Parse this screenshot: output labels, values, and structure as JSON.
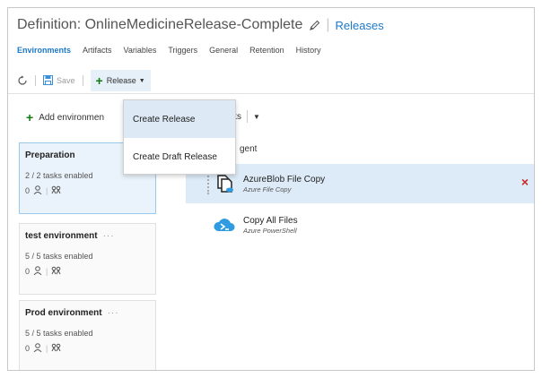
{
  "header": {
    "title": "Definition: OnlineMedicineRelease-Complete",
    "crumb_link": "Releases"
  },
  "tabs": [
    {
      "label": "Environments",
      "active": true
    },
    {
      "label": "Artifacts"
    },
    {
      "label": "Variables"
    },
    {
      "label": "Triggers"
    },
    {
      "label": "General"
    },
    {
      "label": "Retention"
    },
    {
      "label": "History"
    }
  ],
  "toolbar": {
    "save_label": "Save",
    "release_label": "Release"
  },
  "release_menu": {
    "items": [
      "Create Release",
      "Create Draft Release"
    ]
  },
  "left": {
    "add_environment_label": "Add environmen",
    "environments": [
      {
        "name": "Preparation",
        "tasks": "2 / 2 tasks enabled",
        "approvers": "0",
        "selected": true
      },
      {
        "name": "test environment",
        "tasks": "5 / 5 tasks enabled",
        "approvers": "0"
      },
      {
        "name": "Prod environment",
        "tasks": "5 / 5 tasks enabled",
        "approvers": "0"
      }
    ],
    "more": "···"
  },
  "right": {
    "tasks_label": "ks",
    "agent_label": "gent",
    "tasks": [
      {
        "name": "AzureBlob File Copy",
        "subtitle": "Azure File Copy",
        "selected": true
      },
      {
        "name": "Copy All Files",
        "subtitle": "Azure PowerShell"
      }
    ],
    "remove_glyph": "×"
  },
  "colors": {
    "accent": "#1e78c8",
    "plus_green": "#107c10",
    "remove_red": "#c62828",
    "selected_bg": "#dcebf7"
  }
}
